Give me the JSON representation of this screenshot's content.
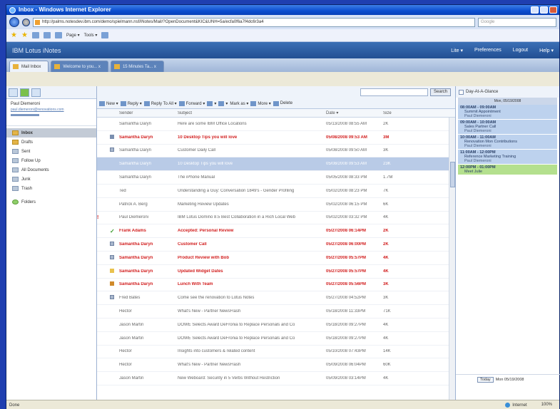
{
  "window": {
    "title": "Inbox - Windows Internet Explorer",
    "url": "http://palms.notesdev.ibm.com/demo/spielmann.nsf/iNotes/Mail/?OpenDocument&KIC&UNH=5a/ecfa0f6a7f4dc6r3a4",
    "search_placeholder": "Google"
  },
  "favbar": {
    "cmd1": "Page ▾",
    "cmd2": "Tools ▾"
  },
  "lotus": {
    "brand": "IBM Lotus iNotes",
    "links": [
      "Lite ▾",
      "Preferences",
      "Logout",
      "Help ▾"
    ]
  },
  "tabs": [
    {
      "label": "Mail Inbox"
    },
    {
      "label": "Welcome to you... x"
    },
    {
      "label": "15 Minutes Ta... x"
    }
  ],
  "left": {
    "user_name": "Paul Diemeroni",
    "user_email": "paul.diemeroni@renovations.com",
    "nav": [
      {
        "label": "Inbox",
        "selected": true,
        "icon": "inbox-icon"
      },
      {
        "label": "Drafts",
        "icon": "drafts-icon"
      },
      {
        "label": "Sent",
        "icon": "sent-icon"
      },
      {
        "label": "Follow Up",
        "icon": "followup-icon"
      },
      {
        "label": "All Documents",
        "icon": "documents-icon"
      },
      {
        "label": "Junk",
        "icon": "junk-icon"
      },
      {
        "label": "Trash",
        "icon": "trash-icon"
      },
      {
        "label": "Folders",
        "icon": "folders-icon"
      }
    ]
  },
  "main": {
    "search_button": "Search",
    "toolbar": [
      "New ▾",
      "Reply ▾",
      "Reply To All ▾",
      "Forward ▾",
      "▾",
      "▾",
      "Mark as ▾",
      "More ▾",
      "Delete"
    ],
    "columns": {
      "sender": "Sender",
      "subject": "Subject",
      "date": "Date ▾",
      "size": "Size"
    },
    "rows": [
      {
        "sender": "Samantha Daryn",
        "subject": "Here are some IBM Office Locations",
        "date": "05/13/2008 08:55 AM",
        "size": "2K",
        "state": "read",
        "icon": ""
      },
      {
        "sender": "Samantha Daryn",
        "subject": "10 Desktop Tips you will love",
        "date": "05/08/2008 09:53 AM",
        "size": "3M",
        "state": "unread",
        "icon": "reply"
      },
      {
        "sender": "Samantha Daryn",
        "subject": "Customer Daily Call",
        "date": "05/08/2008 09:50 AM",
        "size": "3K",
        "state": "read",
        "icon": "cal"
      },
      {
        "sender": "Samantha Daryn",
        "subject": "10 Desktop Tips you will love",
        "date": "05/08/2008 09:53 AM",
        "size": "23K",
        "state": "selected",
        "icon": ""
      },
      {
        "sender": "Samantha Daryn",
        "subject": "The iPhone Manual",
        "date": "05/05/2008 08:33 PM",
        "size": "1.7M",
        "state": "read",
        "icon": ""
      },
      {
        "sender": "Ted",
        "subject": "Understanding a Guy: Conversation 1849's - Gender Profiling",
        "date": "05/02/2008 08:23 PM",
        "size": "7K",
        "state": "read",
        "icon": ""
      },
      {
        "sender": "Patrick A. Berg",
        "subject": "Marketing Review Updates",
        "date": "05/02/2008 06:15 PM",
        "size": "6K",
        "state": "read",
        "icon": ""
      },
      {
        "sender": "Paul Diemeroni",
        "subject": "IBM Lotus Domino 8.5 Best Collaboration in a Rich Local Web",
        "date": "05/02/2008 03:32 PM",
        "size": "4K",
        "state": "read",
        "icon": "flag"
      },
      {
        "sender": "Frank Adams",
        "subject": "Accepted: Personal Review",
        "date": "05/27/2008 06:14PM",
        "size": "2K",
        "state": "unread",
        "icon": "check"
      },
      {
        "sender": "Samantha Daryn",
        "subject": "Customer Call",
        "date": "05/27/2008 06:00PM",
        "size": "2K",
        "state": "unread",
        "icon": "cal"
      },
      {
        "sender": "Samantha Daryn",
        "subject": "Product Review with Bob",
        "date": "05/27/2008 05:57PM",
        "size": "4K",
        "state": "unread",
        "icon": "cal"
      },
      {
        "sender": "Samantha Daryn",
        "subject": "Updated Widget Dates",
        "date": "05/27/2008 05:57PM",
        "size": "4K",
        "state": "unread",
        "icon": "doc"
      },
      {
        "sender": "Samantha Daryn",
        "subject": "Lunch With Team",
        "date": "05/27/2008 05:56PM",
        "size": "3K",
        "state": "unread",
        "icon": "pen"
      },
      {
        "sender": "Fred Bates",
        "subject": "Come see the renovation to Lotus Notes",
        "date": "05/27/2008 04:52PM",
        "size": "3K",
        "state": "read",
        "icon": "cal"
      },
      {
        "sender": "Hector",
        "subject": "What's New - Partner NewsFlash",
        "date": "05/18/2008 11:33PM",
        "size": "71K",
        "state": "read",
        "icon": ""
      },
      {
        "sender": "Jason Martin",
        "subject": "DOWE Selects Award DeFronia to Replace Personals and Co",
        "date": "05/18/2008 09:27PM",
        "size": "4K",
        "state": "read",
        "icon": ""
      },
      {
        "sender": "Jason Martin",
        "subject": "DOWE Selects Award DeFronia to Replace Personals and Co",
        "date": "05/18/2008 09:27PM",
        "size": "4K",
        "state": "read",
        "icon": ""
      },
      {
        "sender": "Hector",
        "subject": "Insights into customers & related content",
        "date": "05/10/2008 07:43PM",
        "size": "14K",
        "state": "read",
        "icon": ""
      },
      {
        "sender": "Hector",
        "subject": "What's New - Partner NewsFlash",
        "date": "05/09/2008 06:04PM",
        "size": "60K",
        "state": "read",
        "icon": ""
      },
      {
        "sender": "Jason Martin",
        "subject": "New Weboard: Security in 5 Verbs Without Restriction",
        "date": "05/09/2008 03:14PM",
        "size": "4K",
        "state": "read",
        "icon": ""
      }
    ]
  },
  "calendar": {
    "header": "Day-At-A-Glance",
    "date": "Mon, 05/19/2008",
    "appointments": [
      {
        "time": "08:00AM - 09:00AM",
        "title": "Summit Appointment",
        "person": "Paul Diemeroni",
        "color": "blue"
      },
      {
        "time": "09:00AM - 10:00AM",
        "title": "Sales Partner Call",
        "person": "Paul Diemeroni",
        "color": "blue"
      },
      {
        "time": "10:00AM - 11:00AM",
        "title": "Renovation Mon Contributions",
        "person": "Paul Diemeroni",
        "color": "blue"
      },
      {
        "time": "11:00AM - 12:00PM",
        "title": "Reference Marketing Training",
        "person": "Paul Diemeroni",
        "color": "blue"
      },
      {
        "time": "12:00PM - 01:00PM",
        "title": "Meet Julie",
        "person": "",
        "color": "green"
      }
    ],
    "today_label": "Today",
    "footer_date": "Mon 05/19/2008"
  },
  "status": {
    "left": "Done",
    "zone": "Internet",
    "zoom": "100%"
  },
  "colors": {
    "unread": "#d22020",
    "selected_row": "#b9cbe7",
    "appt_blue": "#bdd2ee",
    "appt_green": "#b4e08e"
  }
}
